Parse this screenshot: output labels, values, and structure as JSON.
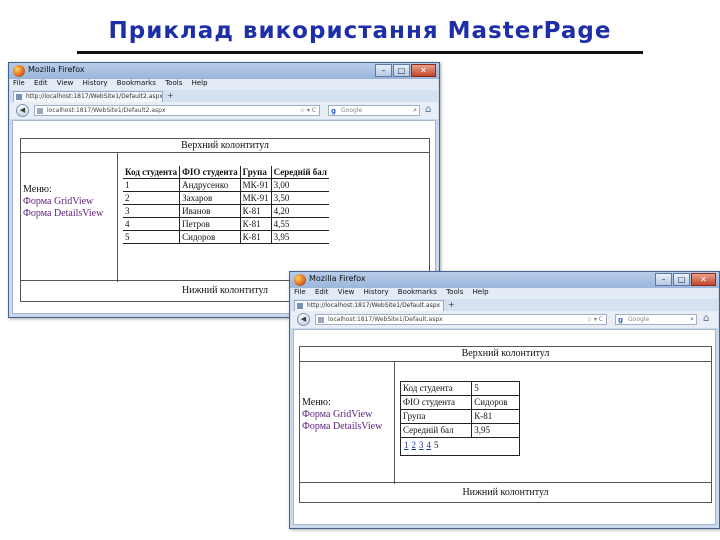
{
  "slide": {
    "title": "Приклад використання MasterPage"
  },
  "browser1": {
    "window_title": "Mozilla Firefox",
    "window_buttons": [
      "–",
      "□",
      "✕"
    ],
    "menu": [
      "File",
      "Edit",
      "View",
      "History",
      "Bookmarks",
      "Tools",
      "Help"
    ],
    "tab_title": "http://localhost:1817/WebSite1/Default2.aspx",
    "tab_plus": "+",
    "nav_back": "◀",
    "url": "localhost:1817/WebSite1/Default2.aspx",
    "url_controls": "☆ ▾ C",
    "search_logo": "g",
    "search_placeholder": "Google",
    "search_icon": "⌕",
    "home_icon": "⌂",
    "page": {
      "header": "Верхний колонтитул",
      "footer": "Нижний колонтитул",
      "menu_title": "Меню:",
      "menu_links": [
        "Форма GridView",
        "Форма DetailsView"
      ],
      "grid": {
        "columns": [
          "Код студента",
          "ФІО студента",
          "Група",
          "Середній бал"
        ],
        "rows": [
          [
            "1",
            "Андрусенко",
            "МК-91",
            "3,00"
          ],
          [
            "2",
            "Захаров",
            "МК-91",
            "3,50"
          ],
          [
            "3",
            "Иванов",
            "К-81",
            "4,20"
          ],
          [
            "4",
            "Петров",
            "К-81",
            "4,55"
          ],
          [
            "5",
            "Сидоров",
            "К-81",
            "3,95"
          ]
        ]
      }
    }
  },
  "browser2": {
    "window_title": "Mozilla Firefox",
    "window_buttons": [
      "–",
      "□",
      "✕"
    ],
    "menu": [
      "File",
      "Edit",
      "View",
      "History",
      "Bookmarks",
      "Tools",
      "Help"
    ],
    "tab_title": "http://localhost:1817/WebSite1/Default.aspx",
    "tab_plus": "+",
    "nav_back": "◀",
    "url": "localhost:1817/WebSite1/Default.aspx",
    "url_controls": "☆ ▾ C",
    "search_logo": "g",
    "search_placeholder": "Google",
    "search_icon": "⌕",
    "home_icon": "⌂",
    "page": {
      "header": "Верхний колонтитул",
      "footer": "Нижний колонтитул",
      "menu_title": "Меню:",
      "menu_links": [
        "Форма GridView",
        "Форма DetailsView"
      ],
      "details": {
        "rows": [
          [
            "Код студента",
            "5"
          ],
          [
            "ФІО студента",
            "Сидоров"
          ],
          [
            "Група",
            "К-81"
          ],
          [
            "Середній бал",
            "3,95"
          ]
        ],
        "pager": [
          "1",
          "2",
          "3",
          "4",
          "5"
        ],
        "current_page": "5"
      }
    }
  }
}
